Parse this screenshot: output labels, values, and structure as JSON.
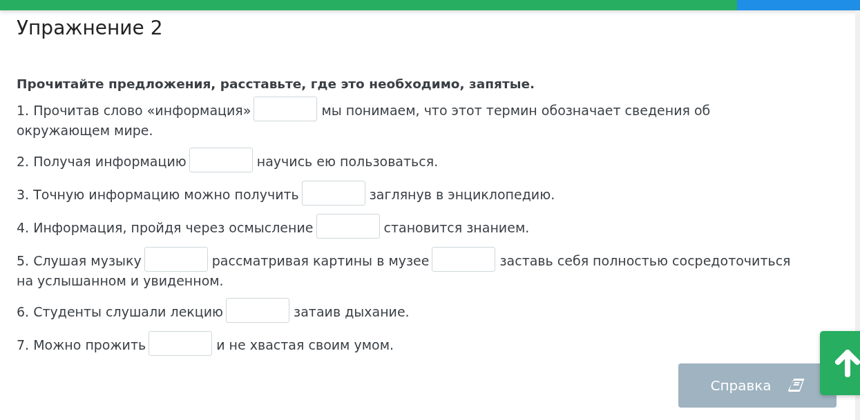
{
  "progress": {
    "level": 0.857
  },
  "title": "Упражнение 2",
  "instruction": "Прочитайте предложения, расставьте, где это необходимо, запятые.",
  "sentences": [
    {
      "parts": [
        {
          "kind": "text",
          "text": "1. Прочитав слово «информация»"
        },
        {
          "kind": "blank"
        },
        {
          "kind": "text",
          "text": "мы понимаем, что этот термин обозначает сведения об"
        },
        {
          "kind": "line",
          "text": "окружающем мире."
        }
      ]
    },
    {
      "parts": [
        {
          "kind": "text",
          "text": "2. Получая информацию"
        },
        {
          "kind": "blank"
        },
        {
          "kind": "text",
          "text": "научись ею пользоваться."
        }
      ]
    },
    {
      "parts": [
        {
          "kind": "text",
          "text": "3. Точную информацию можно получить"
        },
        {
          "kind": "blank"
        },
        {
          "kind": "text",
          "text": "заглянув в энциклопедию."
        }
      ]
    },
    {
      "parts": [
        {
          "kind": "text",
          "text": "4. Информация, пройдя через осмысление"
        },
        {
          "kind": "blank"
        },
        {
          "kind": "text",
          "text": "становится знанием."
        }
      ]
    },
    {
      "parts": [
        {
          "kind": "text",
          "text": "5. Слушая музыку"
        },
        {
          "kind": "blank"
        },
        {
          "kind": "text",
          "text": "рассматривая картины в музее"
        },
        {
          "kind": "blank"
        },
        {
          "kind": "text",
          "text": "заставь себя полностью сосредоточиться"
        },
        {
          "kind": "line",
          "text": "на услышанном и увиденном."
        }
      ]
    },
    {
      "parts": [
        {
          "kind": "text",
          "text": "6. Студенты слушали лекцию"
        },
        {
          "kind": "blank"
        },
        {
          "kind": "text",
          "text": "затаив дыхание."
        }
      ]
    },
    {
      "parts": [
        {
          "kind": "text",
          "text": "7. Можно прожить"
        },
        {
          "kind": "blank"
        },
        {
          "kind": "text",
          "text": "и не хвастая своим умом."
        }
      ]
    }
  ],
  "help_button": {
    "label": "Справка"
  }
}
